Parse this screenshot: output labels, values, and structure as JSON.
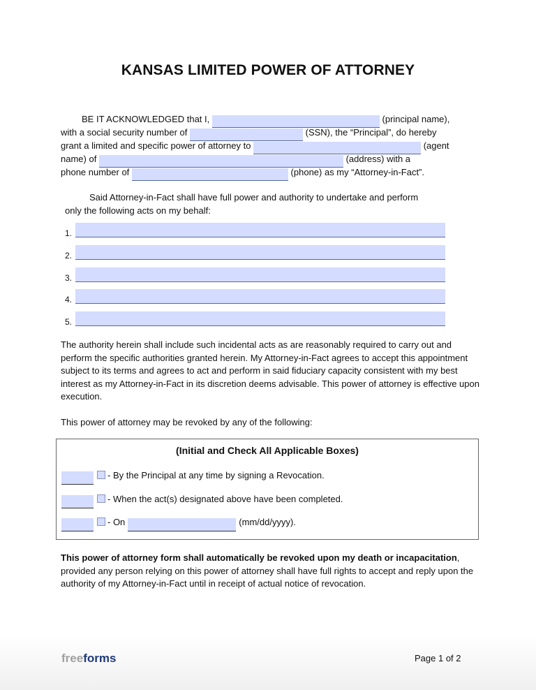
{
  "document": {
    "title": "KANSAS LIMITED POWER OF ATTORNEY",
    "intro": {
      "l1_pre": "BE IT ACKNOWLEDGED that I,",
      "l1_post": "(principal name),",
      "l2_pre": "with a social security number of",
      "l2_post": "(SSN), the “Principal”, do hereby",
      "l3_pre": "grant a limited and specific power of attorney to",
      "l3_post": "(agent",
      "l4_pre": "name) of",
      "l4_post": "(address) with a",
      "l5_pre": "phone number of",
      "l5_post": "(phone) as my “Attorney-in-Fact”."
    },
    "fields": {
      "principal_name": "",
      "ssn": "",
      "agent_name": "",
      "address": "",
      "phone": ""
    },
    "acts_intro_l1": "Said Attorney-in-Fact shall have full power and authority to undertake and perform",
    "acts_intro_l2": "only the following acts on my behalf:",
    "acts": [
      {
        "number": "1.",
        "value": ""
      },
      {
        "number": "2.",
        "value": ""
      },
      {
        "number": "3.",
        "value": ""
      },
      {
        "number": "4.",
        "value": ""
      },
      {
        "number": "5.",
        "value": ""
      }
    ],
    "authority_paragraph": "The authority herein shall include such incidental acts as are reasonably required to carry out and perform the specific authorities granted herein. My Attorney-in-Fact agrees to accept this appointment subject to its terms and agrees to act and perform in said fiduciary capacity consistent with my best interest as my Attorney-in-Fact in its discretion deems advisable. This power of attorney is effective upon execution.",
    "revoke_intro": "This power of attorney may be revoked by any of the following:",
    "revocation_box": {
      "title": "(Initial and Check All Applicable Boxes)",
      "options": [
        {
          "label": "- By the Principal at any time by signing a Revocation.",
          "initial": "",
          "checked": false
        },
        {
          "label": "- When the act(s) designated above have been completed.",
          "initial": "",
          "checked": false
        },
        {
          "label": "- On",
          "initial": "",
          "checked": false,
          "date": "",
          "date_hint": "(mm/dd/yyyy)."
        }
      ]
    },
    "final_bold": "This power of attorney form shall automatically be revoked upon my death or incapacitation",
    "final_rest": ", provided any person relying on this power of attorney shall have full rights to accept and reply upon the authority of my Attorney-in-Fact until in receipt of actual notice of revocation."
  },
  "footer": {
    "logo_part1": "free",
    "logo_part2": "forms",
    "page_label": "Page 1 of 2"
  },
  "colors": {
    "field_fill": "#d4dcff",
    "logo_dark": "#1f3a78",
    "logo_light": "#a0a0a0"
  }
}
